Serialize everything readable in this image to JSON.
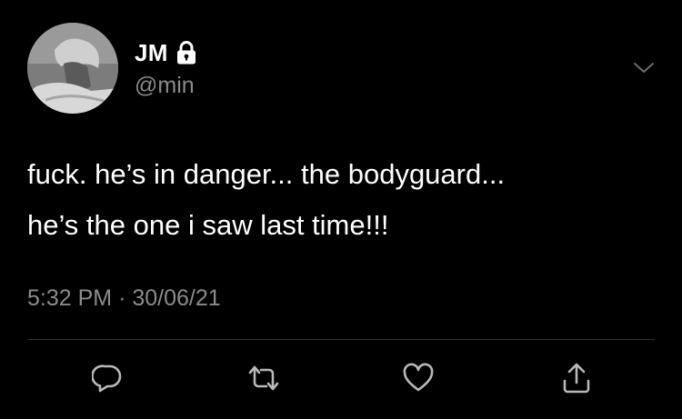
{
  "author": {
    "display_name": "JM",
    "handle": "@min",
    "avatar_icon": "avatar-photo",
    "protected_icon": "lock-icon"
  },
  "tweet": {
    "text": "fuck. he’s in danger... the bodyguard...\nhe’s the one i saw last time!!!",
    "time": "5:32 PM",
    "separator": "·",
    "date": "30/06/21"
  },
  "actions": [
    {
      "name": "reply",
      "icon": "reply-icon"
    },
    {
      "name": "retweet",
      "icon": "retweet-icon"
    },
    {
      "name": "like",
      "icon": "heart-icon"
    },
    {
      "name": "share",
      "icon": "share-icon"
    }
  ],
  "colors": {
    "background": "#000000",
    "text": "#ffffff",
    "secondary_text": "#8b8b8b",
    "divider": "#2f3336",
    "icon": "#b8b8b8"
  }
}
